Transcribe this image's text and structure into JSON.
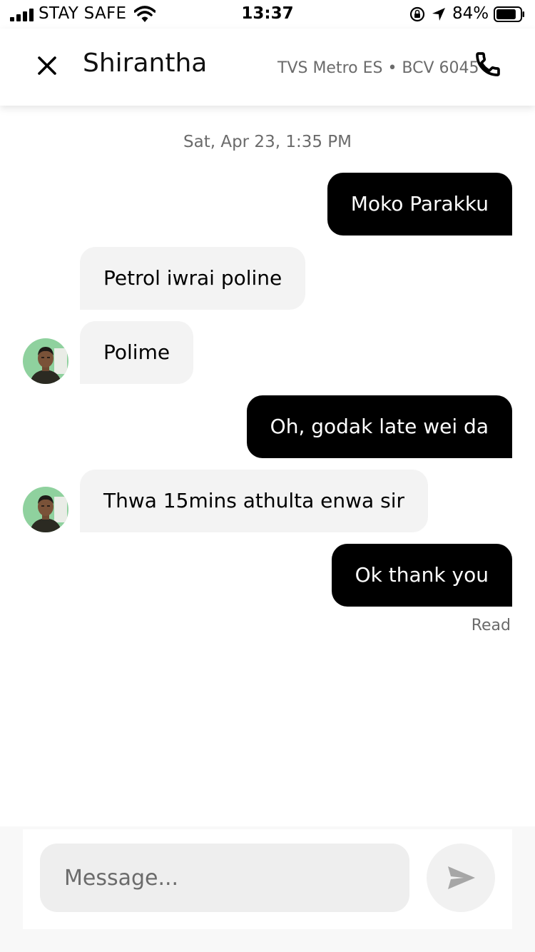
{
  "status_bar": {
    "carrier": "STAY SAFE",
    "time": "13:37",
    "battery_percent": "84%",
    "battery_level": 0.84,
    "icons": [
      "signal-icon",
      "wifi-icon",
      "rotation-lock-icon",
      "location-arrow-icon",
      "battery-icon"
    ]
  },
  "header": {
    "contact_name": "Shirantha",
    "vehicle": "TVS Metro ES • BCV 6045",
    "close_icon": "close-icon",
    "phone_icon": "phone-icon"
  },
  "chat": {
    "timestamp": "Sat, Apr 23, 1:35 PM",
    "messages": [
      {
        "direction": "outgoing",
        "text": "Moko Parakku"
      },
      {
        "direction": "incoming",
        "text": "Petrol iwrai poline"
      },
      {
        "direction": "incoming",
        "text": "Polime"
      },
      {
        "direction": "outgoing",
        "text": "Oh, godak late wei da"
      },
      {
        "direction": "incoming",
        "text": "Thwa 15mins athulta enwa sir"
      },
      {
        "direction": "outgoing",
        "text": "Ok thank you"
      }
    ],
    "read_receipt": "Read"
  },
  "composer": {
    "placeholder": "Message...",
    "value": "",
    "send_icon": "send-icon"
  },
  "colors": {
    "outgoing_bubble": "#000000",
    "incoming_bubble": "#f3f3f3",
    "secondary_text": "#6b6b6b",
    "avatar_background": "#8fd19e"
  }
}
